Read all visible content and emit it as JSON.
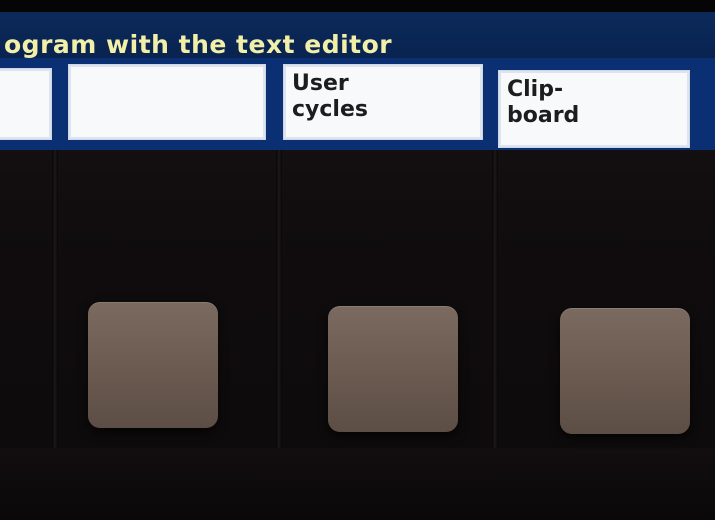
{
  "header": {
    "title": "ogram with the text editor"
  },
  "softkeys": [
    {
      "label": ""
    },
    {
      "label": ""
    },
    {
      "label": "User\ncycles"
    },
    {
      "label": "Clip-\nboard"
    }
  ],
  "colors": {
    "header_bg": "#0a2350",
    "title_text": "#f2f0a8",
    "softkey_bg": "#f7f9fb",
    "softkey_text": "#1d1d1d",
    "bezel": "#110d0f",
    "hardware_key": "#6a5a50"
  }
}
